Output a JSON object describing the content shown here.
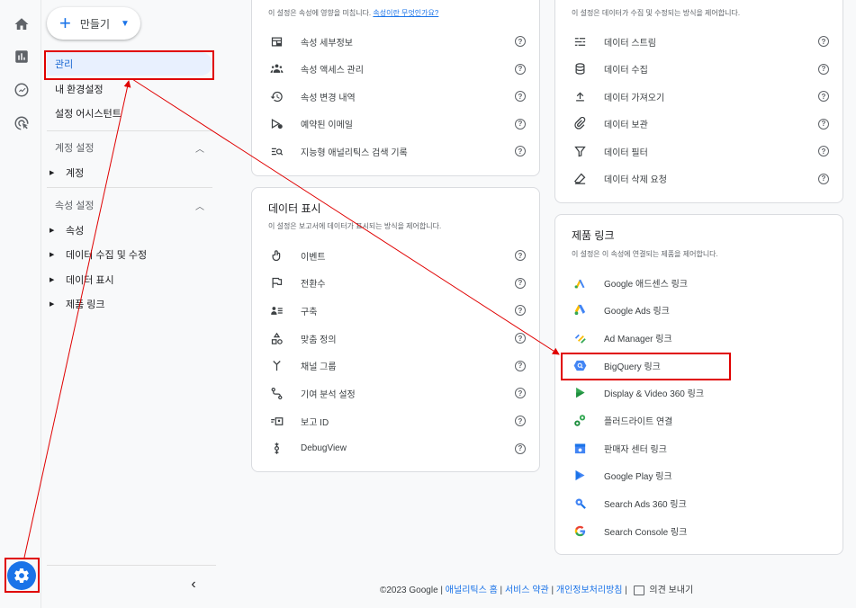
{
  "nav": {
    "create_label": "만들기",
    "items": [
      {
        "label": "관리"
      },
      {
        "label": "내 환경설정"
      },
      {
        "label": "설정 어시스턴트"
      }
    ],
    "account_section": {
      "title": "계정 설정",
      "items": [
        "계정"
      ]
    },
    "property_section": {
      "title": "속성 설정",
      "items": [
        "속성",
        "데이터 수집 및 수정",
        "데이터 표시",
        "제품 링크"
      ]
    }
  },
  "property_card": {
    "desc": "이 설정은 속성에 영향을 미칩니다.",
    "desc_link": "속성이란 무엇인가요?",
    "rows": [
      "속성 세부정보",
      "속성 액세스 관리",
      "속성 변경 내역",
      "예약된 이메일",
      "지능형 애널리틱스 검색 기록"
    ]
  },
  "data_display_card": {
    "title": "데이터 표시",
    "desc": "이 설정은 보고서에 데이터가 표시되는 방식을 제어합니다.",
    "rows": [
      "이벤트",
      "전환수",
      "구축",
      "맞춤 정의",
      "채널 그룹",
      "기여 분석 설정",
      "보고 ID",
      "DebugView"
    ]
  },
  "data_collection_card": {
    "desc": "이 설정은 데이터가 수집 및 수정되는 방식을 제어합니다.",
    "rows": [
      "데이터 스트림",
      "데이터 수집",
      "데이터 가져오기",
      "데이터 보관",
      "데이터 필터",
      "데이터 삭제 요청"
    ]
  },
  "product_links_card": {
    "title": "제품 링크",
    "desc": "이 설정은 이 속성에 연결되는 제품을 제어합니다.",
    "rows": [
      "Google 애드센스 링크",
      "Google Ads 링크",
      "Ad Manager 링크",
      "BigQuery 링크",
      "Display & Video 360 링크",
      "플러드라이트 연결",
      "판매자 센터 링크",
      "Google Play 링크",
      "Search Ads 360 링크",
      "Search Console 링크"
    ]
  },
  "footer": {
    "copyright": "©2023 Google |",
    "home": "애널리틱스 홈",
    "terms": "서비스 약관",
    "privacy": "개인정보처리방침",
    "feedback": "의견 보내기"
  },
  "colors": {
    "accent": "#1a73e8",
    "annotation": "#e00000"
  }
}
